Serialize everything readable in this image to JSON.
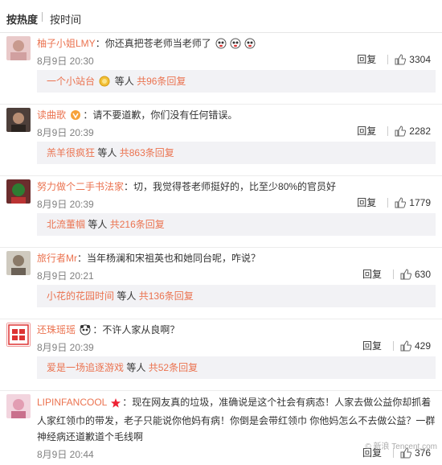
{
  "sort": {
    "hot": "按热度",
    "time": "按时间"
  },
  "comments": [
    {
      "user": "柚子小姐LMY",
      "text": "你还真把苍老师当老师了",
      "time": "8月9日 20:30",
      "reply": "回复",
      "likes": "3304",
      "sub_user": "一个小站台",
      "sub_mid": "等人",
      "sub_count": "共96条回复"
    },
    {
      "user": "读曲歌",
      "text": "请不要道歉，你们没有任何错误。",
      "time": "8月9日 20:39",
      "reply": "回复",
      "likes": "2282",
      "sub_user": "羔羊很疯狂",
      "sub_mid": "等人",
      "sub_count": "共863条回复"
    },
    {
      "user": "努力做个二手书法家",
      "text": "切，我觉得苍老师挺好的，比至少80%的官员好",
      "time": "8月9日 20:39",
      "reply": "回复",
      "likes": "1779",
      "sub_user": "北流董帼",
      "sub_mid": "等人",
      "sub_count": "共216条回复"
    },
    {
      "user": "旅行者Mr",
      "text": "当年杨澜和宋祖英也和她同台呢，咋说？",
      "time": "8月9日 20:21",
      "reply": "回复",
      "likes": "630",
      "sub_user": "小花的花园时间",
      "sub_mid": "等人",
      "sub_count": "共136条回复"
    },
    {
      "user": "还珠瑶瑶",
      "text": "不许人家从良啊？",
      "time": "8月9日 20:39",
      "reply": "回复",
      "likes": "429",
      "sub_user": "爱是一场追逐游戏",
      "sub_mid": "等人",
      "sub_count": "共52条回复"
    },
    {
      "user": "LIPINFANCOOL",
      "text": "现在网友真的垃圾，准确说是这个社会有病态！人家去做公益你却抓着人家红领巾的带发，老子只能说你他妈有病！你倒是会带红领巾 你他妈怎么不去做公益？一群神经病还道歉道个毛线啊",
      "time": "8月9日 20:44",
      "reply": "回复",
      "likes": "376"
    }
  ],
  "watermark": "© 新浪 Tencent.com"
}
